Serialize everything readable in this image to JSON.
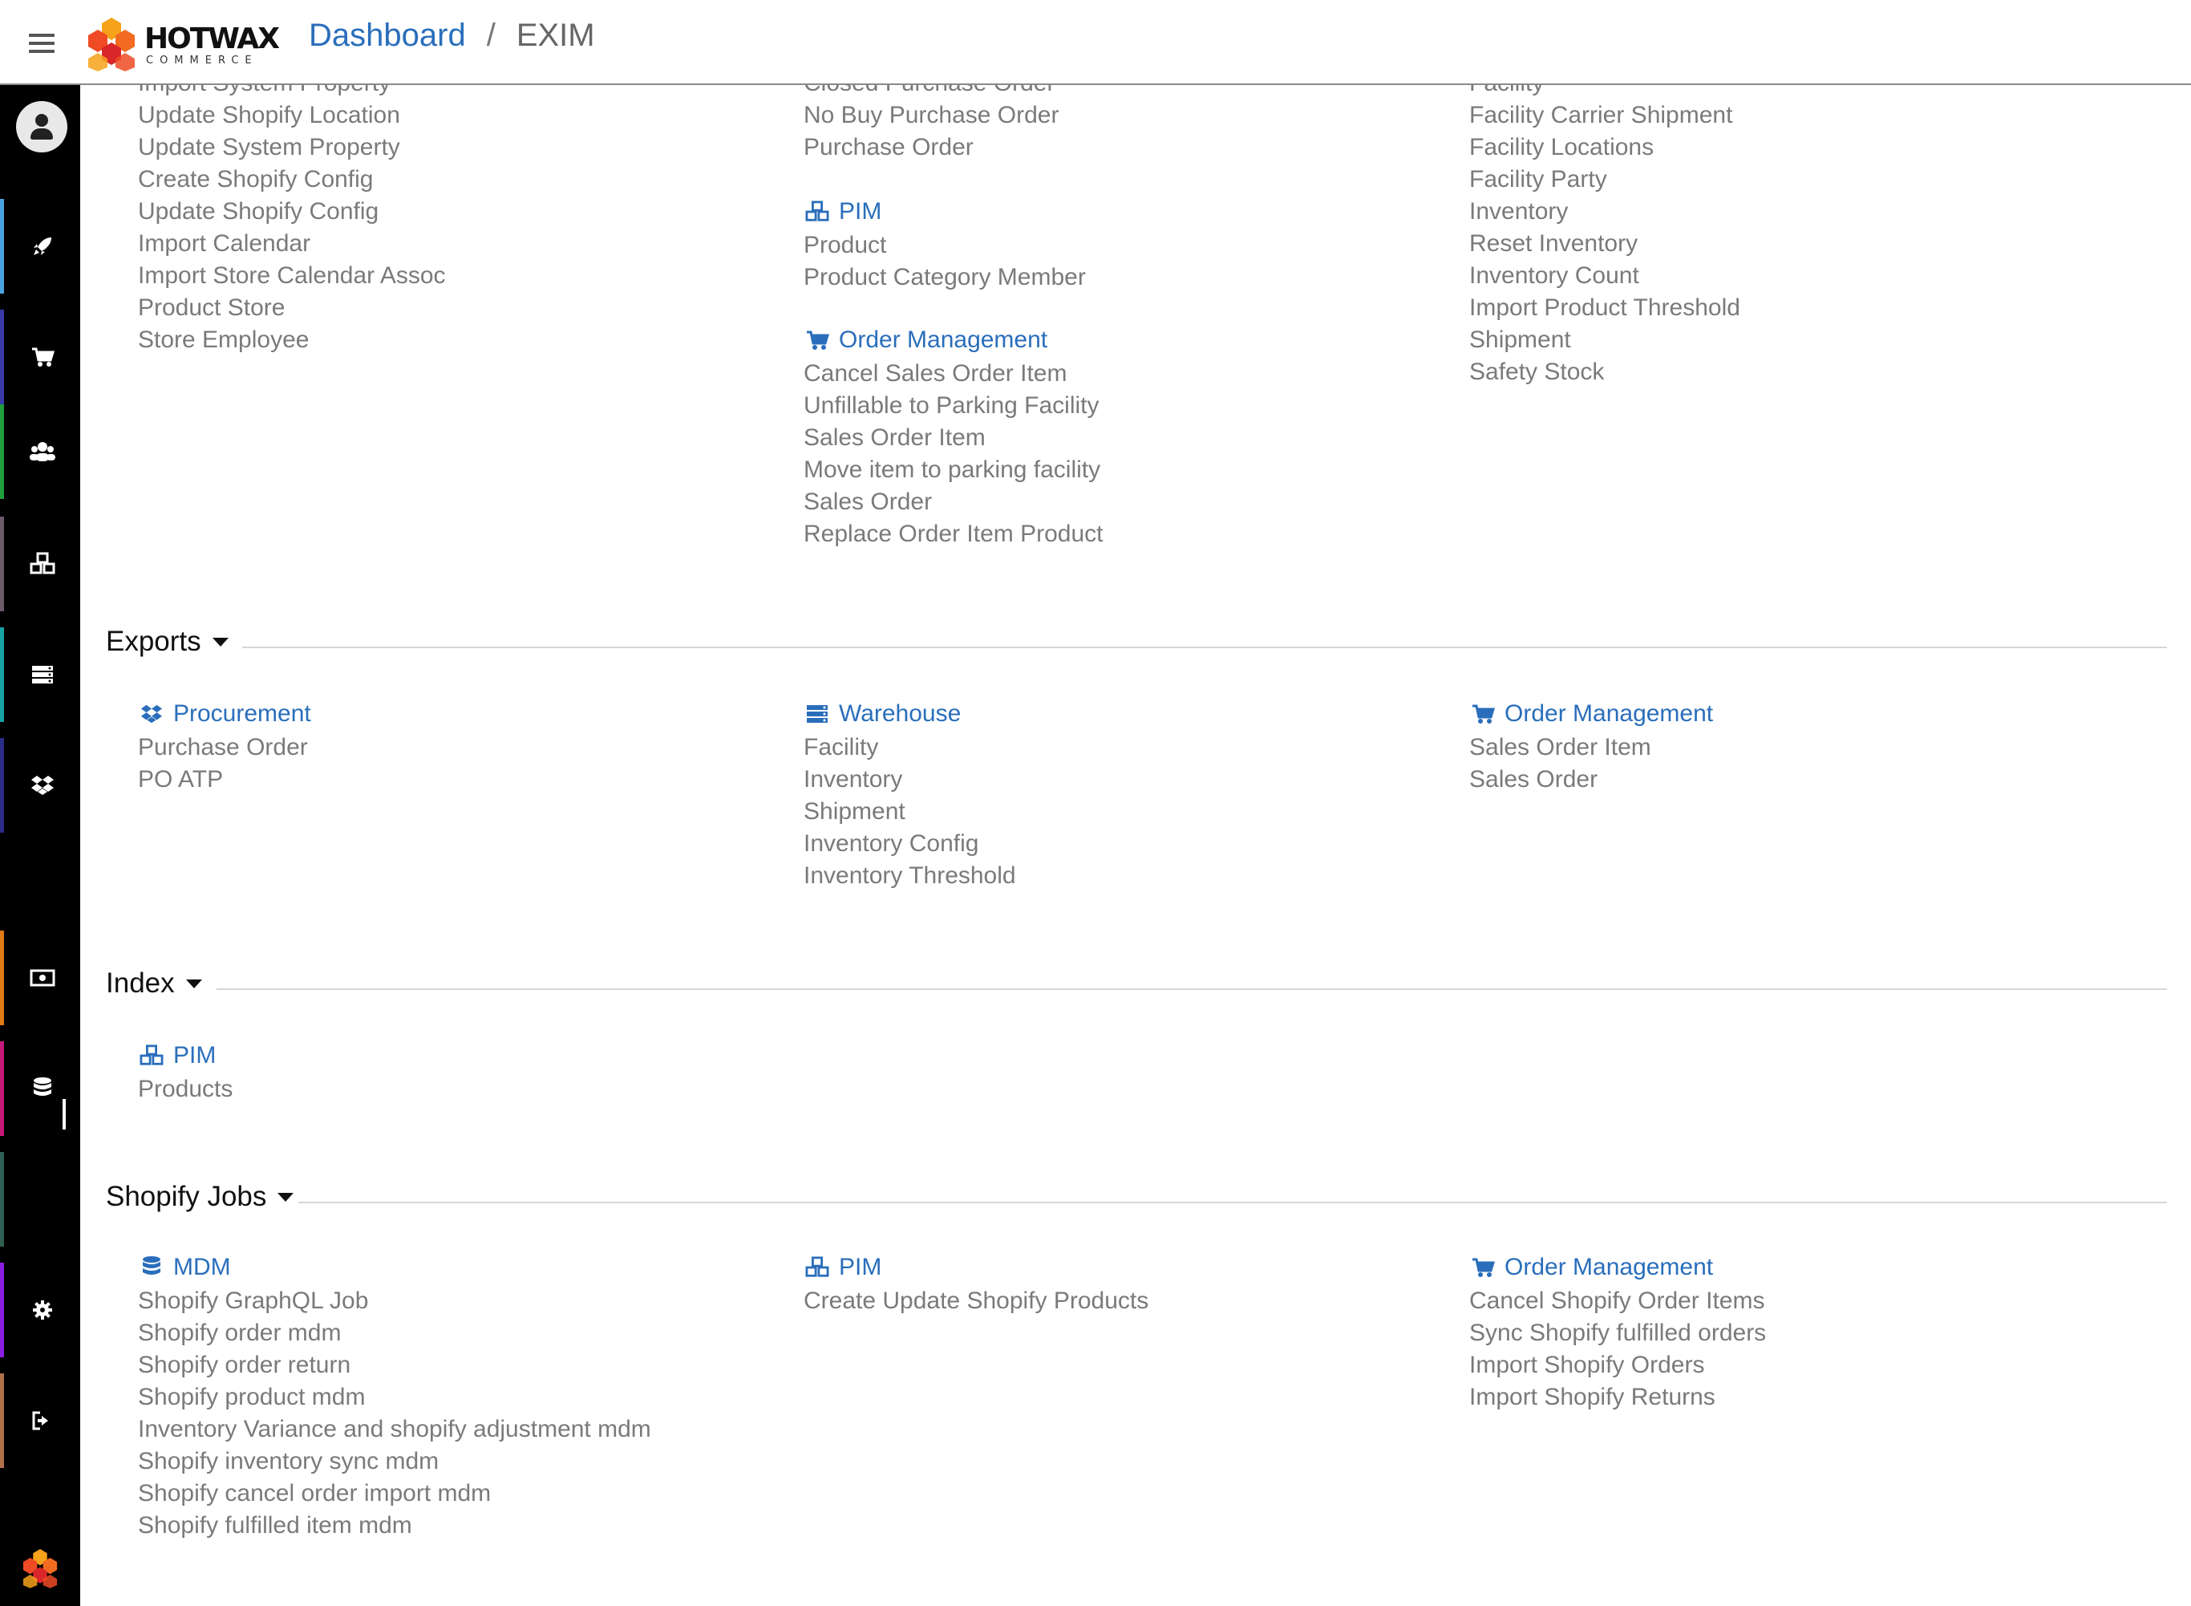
{
  "header": {
    "brand": "HOTWAX",
    "brand_sub": "COMMERCE",
    "breadcrumb_link": "Dashboard",
    "breadcrumb_sep": "/",
    "breadcrumb_current": "EXIM"
  },
  "sidebar": {
    "items": [
      {
        "icon": "rocket-icon",
        "stripe": "#4aa3df"
      },
      {
        "icon": "cart-icon",
        "stripe": "#3a3aa8"
      },
      {
        "icon": "users-icon",
        "stripe": "#1f9e3a"
      },
      {
        "icon": "cubes-icon",
        "stripe": "#6a5a6a"
      },
      {
        "icon": "server-icon",
        "stripe": "#17a3a3"
      },
      {
        "icon": "dropbox-icon",
        "stripe": "#2c2c8a"
      },
      {
        "icon": "money-icon",
        "stripe": "#e07b16"
      },
      {
        "icon": "database-icon",
        "stripe": "#c7197a"
      },
      {
        "icon": "blank-icon",
        "stripe": "#2f5e52"
      },
      {
        "icon": "gear-icon",
        "stripe": "#8a1ee0"
      },
      {
        "icon": "sign-out-icon",
        "stripe": "#b0704a"
      }
    ]
  },
  "imports": {
    "col1": [
      "Import System Property",
      "Update Shopify Location",
      "Update System Property",
      "Create Shopify Config",
      "Update Shopify Config",
      "Import Calendar",
      "Import Store Calendar Assoc",
      "Product Store",
      "Store Employee"
    ],
    "col2_top": [
      "Closed Purchase Order",
      "No Buy Purchase Order",
      "Purchase Order"
    ],
    "pim": {
      "title": "PIM",
      "items": [
        "Product",
        "Product Category Member"
      ]
    },
    "order_management": {
      "title": "Order Management",
      "items": [
        "Cancel Sales Order Item",
        "Unfillable to Parking Facility",
        "Sales Order Item",
        "Move item to parking facility",
        "Sales Order",
        "Replace Order Item Product"
      ]
    },
    "col3": [
      "Facility",
      "Facility Carrier Shipment",
      "Facility Locations",
      "Facility Party",
      "Inventory",
      "Reset Inventory",
      "Inventory Count",
      "Import Product Threshold",
      "Shipment",
      "Safety Stock"
    ]
  },
  "exports": {
    "title": "Exports",
    "procurement": {
      "title": "Procurement",
      "items": [
        "Purchase Order",
        "PO ATP"
      ]
    },
    "warehouse": {
      "title": "Warehouse",
      "items": [
        "Facility",
        "Inventory",
        "Shipment",
        "Inventory Config",
        "Inventory Threshold"
      ]
    },
    "order_management": {
      "title": "Order Management",
      "items": [
        "Sales Order Item",
        "Sales Order"
      ]
    }
  },
  "index": {
    "title": "Index",
    "pim": {
      "title": "PIM",
      "items": [
        "Products"
      ]
    }
  },
  "shopify_jobs": {
    "title": "Shopify Jobs",
    "mdm": {
      "title": "MDM",
      "items": [
        "Shopify GraphQL Job",
        "Shopify order mdm",
        "Shopify order return",
        "Shopify product mdm",
        "Inventory Variance and shopify adjustment mdm",
        "Shopify inventory sync mdm",
        "Shopify cancel order import mdm",
        "Shopify fulfilled item mdm"
      ]
    },
    "pim": {
      "title": "PIM",
      "items": [
        "Create Update Shopify Products"
      ]
    },
    "order_management": {
      "title": "Order Management",
      "items": [
        "Cancel Shopify Order Items",
        "Sync Shopify fulfilled orders",
        "Import Shopify Orders",
        "Import Shopify Returns"
      ]
    }
  },
  "colors": {
    "link_blue": "#2a6ebb",
    "muted_text": "#7a7a7a",
    "sidebar_bg": "#000000"
  }
}
